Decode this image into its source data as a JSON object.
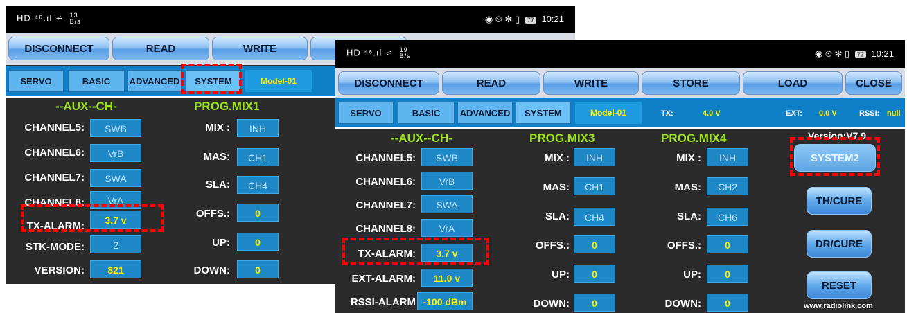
{
  "status": {
    "left_screen": {
      "icons": "HD ⁴⁶.ıl ⩫",
      "speed": "13",
      "speed_unit": "B/s",
      "battery": "77",
      "time": "10:21"
    },
    "right_screen": {
      "icons": "HD ⁴⁶.ıl ⩫",
      "speed": "19",
      "speed_unit": "B/s",
      "battery": "77",
      "time": "10:21"
    },
    "right_icons": "◉ ⏲ ✻ ▯"
  },
  "toolbar": {
    "disconnect": "DISCONNECT",
    "read": "READ",
    "write": "WRITE",
    "store": "STORE",
    "load": "LOAD",
    "close": "CLOSE"
  },
  "tabs": {
    "servo": "SERVO",
    "basic": "BASIC",
    "advanced": "ADVANCED",
    "system": "SYSTEM",
    "model": "Model-01"
  },
  "telemetry": {
    "tx_label": "TX:",
    "tx_value": "4.0 V",
    "ext_label": "EXT:",
    "ext_value": "0.0 V",
    "rssi_label": "RSSI:",
    "rssi_value": "null"
  },
  "aux": {
    "header": "--AUX--CH-",
    "ch5_label": "CHANNEL5:",
    "ch5": "SWB",
    "ch6_label": "CHANNEL6:",
    "ch6": "VrB",
    "ch7_label": "CHANNEL7:",
    "ch7": "SWA",
    "ch8_label": "CHANNEL8:",
    "ch8": "VrA",
    "tx_alarm_label": "TX-ALARM:",
    "tx_alarm": "3.7  v",
    "stk_mode_label": "STK-MODE:",
    "stk_mode": "2",
    "version_label": "VERSION:",
    "version": "821",
    "ext_alarm_label": "EXT-ALARM:",
    "ext_alarm": "11.0  v",
    "rssi_alarm_label": "RSSI-ALARM",
    "rssi_alarm": "-100 dBm"
  },
  "mix1": {
    "header": "PROG.MIX1",
    "mix_label": "MIX :",
    "mix": "INH",
    "mas_label": "MAS:",
    "mas": "CH1",
    "sla_label": "SLA:",
    "sla": "CH4",
    "offs_label": "OFFS.:",
    "offs": "0",
    "up_label": "UP:",
    "up": "0",
    "down_label": "DOWN:",
    "down": "0"
  },
  "mix3": {
    "header": "PROG.MIX3",
    "mix_label": "MIX :",
    "mix": "INH",
    "mas_label": "MAS:",
    "mas": "CH1",
    "sla_label": "SLA:",
    "sla": "CH4",
    "offs_label": "OFFS.:",
    "offs": "0",
    "up_label": "UP:",
    "up": "0",
    "down_label": "DOWN:",
    "down": "0"
  },
  "mix4": {
    "header": "PROG.MIX4",
    "mix_label": "MIX :",
    "mix": "INH",
    "mas_label": "MAS:",
    "mas": "CH2",
    "sla_label": "SLA:",
    "sla": "CH6",
    "offs_label": "OFFS.:",
    "offs": "0",
    "up_label": "UP:",
    "up": "0",
    "down_label": "DOWN:",
    "down": "0"
  },
  "side": {
    "version": "Version:V7.9",
    "system2": "SYSTEM2",
    "th_cure": "TH/CURE",
    "dr_cure": "DR/CURE",
    "reset": "RESET",
    "website": "www.radiolink.com"
  },
  "colors": {
    "highlight": "#ff0000",
    "accent": "#9be31a",
    "value_yellow": "#ffef00",
    "tab_blue": "#0f7fc8"
  }
}
